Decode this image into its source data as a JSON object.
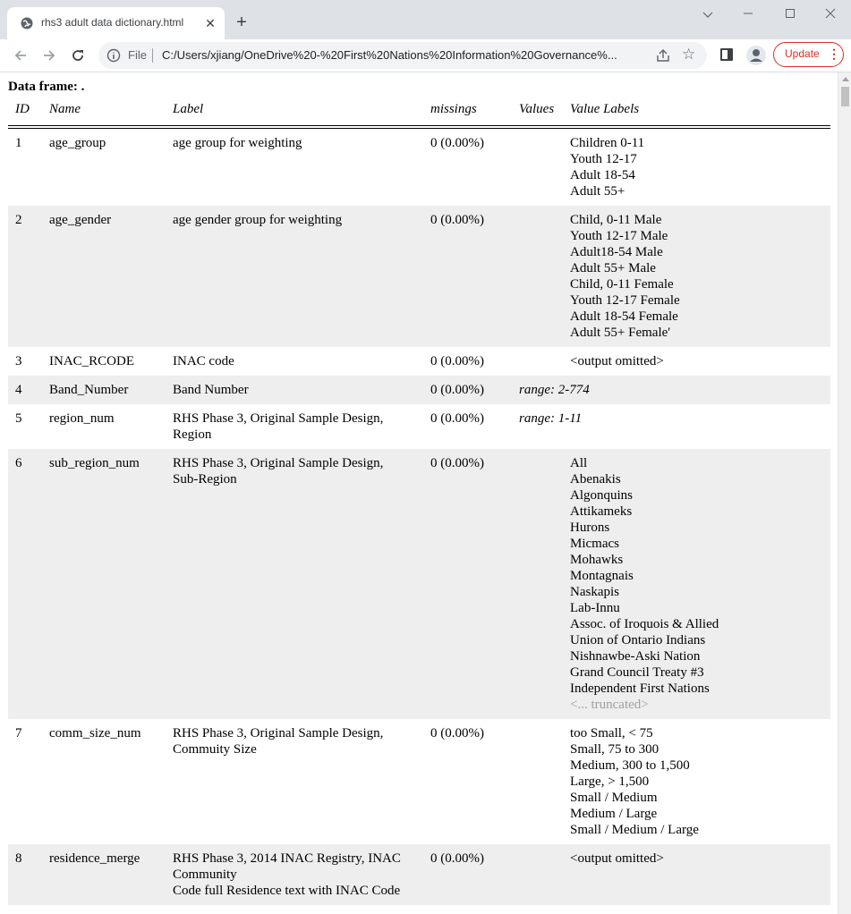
{
  "browser": {
    "tab_title": "rhs3 adult data dictionary.html",
    "file_label": "File",
    "url": "C:/Users/xjiang/OneDrive%20-%20First%20Nations%20Information%20Governance%...",
    "update_label": "Update"
  },
  "page": {
    "heading": "Data frame: .",
    "columns": [
      "ID",
      "Name",
      "Label",
      "missings",
      "Values",
      "Value Labels"
    ],
    "rows": [
      {
        "id": "1",
        "name": "age_group",
        "label": [
          "age group for weighting"
        ],
        "missings": "0 (0.00%)",
        "values": "",
        "value_labels": [
          "Children 0-11",
          "Youth 12-17",
          "Adult 18-54",
          "Adult 55+"
        ]
      },
      {
        "id": "2",
        "name": "age_gender",
        "label": [
          "age gender group for weighting"
        ],
        "missings": "0 (0.00%)",
        "values": "",
        "value_labels": [
          "Child, 0-11 Male",
          "Youth 12-17 Male",
          "Adult18-54 Male",
          "Adult 55+ Male",
          "Child, 0-11 Female",
          "Youth 12-17 Female",
          "Adult 18-54 Female",
          "Adult 55+ Female'"
        ]
      },
      {
        "id": "3",
        "name": "INAC_RCODE",
        "label": [
          "INAC code"
        ],
        "missings": "0 (0.00%)",
        "values": "",
        "value_labels": [
          "<output omitted>"
        ]
      },
      {
        "id": "4",
        "name": "Band_Number",
        "label": [
          "Band Number"
        ],
        "missings": "0 (0.00%)",
        "values": "range: 2-774",
        "value_labels": []
      },
      {
        "id": "5",
        "name": "region_num",
        "label": [
          "RHS Phase 3, Original Sample Design,",
          "Region"
        ],
        "missings": "0 (0.00%)",
        "values": "range: 1-11",
        "value_labels": []
      },
      {
        "id": "6",
        "name": "sub_region_num",
        "label": [
          "RHS Phase 3, Original Sample Design,",
          "Sub-Region"
        ],
        "missings": "0 (0.00%)",
        "values": "",
        "value_labels": [
          "All",
          "Abenakis",
          "Algonquins",
          "Attikameks",
          "Hurons",
          "Micmacs",
          "Mohawks",
          "Montagnais",
          "Naskapis",
          "Lab-Innu",
          "Assoc. of Iroquois & Allied",
          "Union of Ontario Indians",
          "Nishnawbe-Aski Nation",
          "Grand Council Treaty #3",
          "Independent First Nations"
        ],
        "truncated_note": "<... truncated>"
      },
      {
        "id": "7",
        "name": "comm_size_num",
        "label": [
          "RHS Phase 3, Original Sample Design,",
          "Commuity Size"
        ],
        "missings": "0 (0.00%)",
        "values": "",
        "value_labels": [
          "too Small, < 75",
          "Small, 75 to 300",
          "Medium, 300 to 1,500",
          "Large, > 1,500",
          "Small / Medium",
          "Medium / Large",
          "Small / Medium / Large"
        ]
      },
      {
        "id": "8",
        "name": "residence_merge",
        "label": [
          "RHS Phase 3, 2014 INAC Registry, INAC",
          "Community",
          "Code full Residence text with INAC Code"
        ],
        "missings": "0 (0.00%)",
        "values": "",
        "value_labels": [
          "<output omitted>"
        ]
      }
    ]
  }
}
